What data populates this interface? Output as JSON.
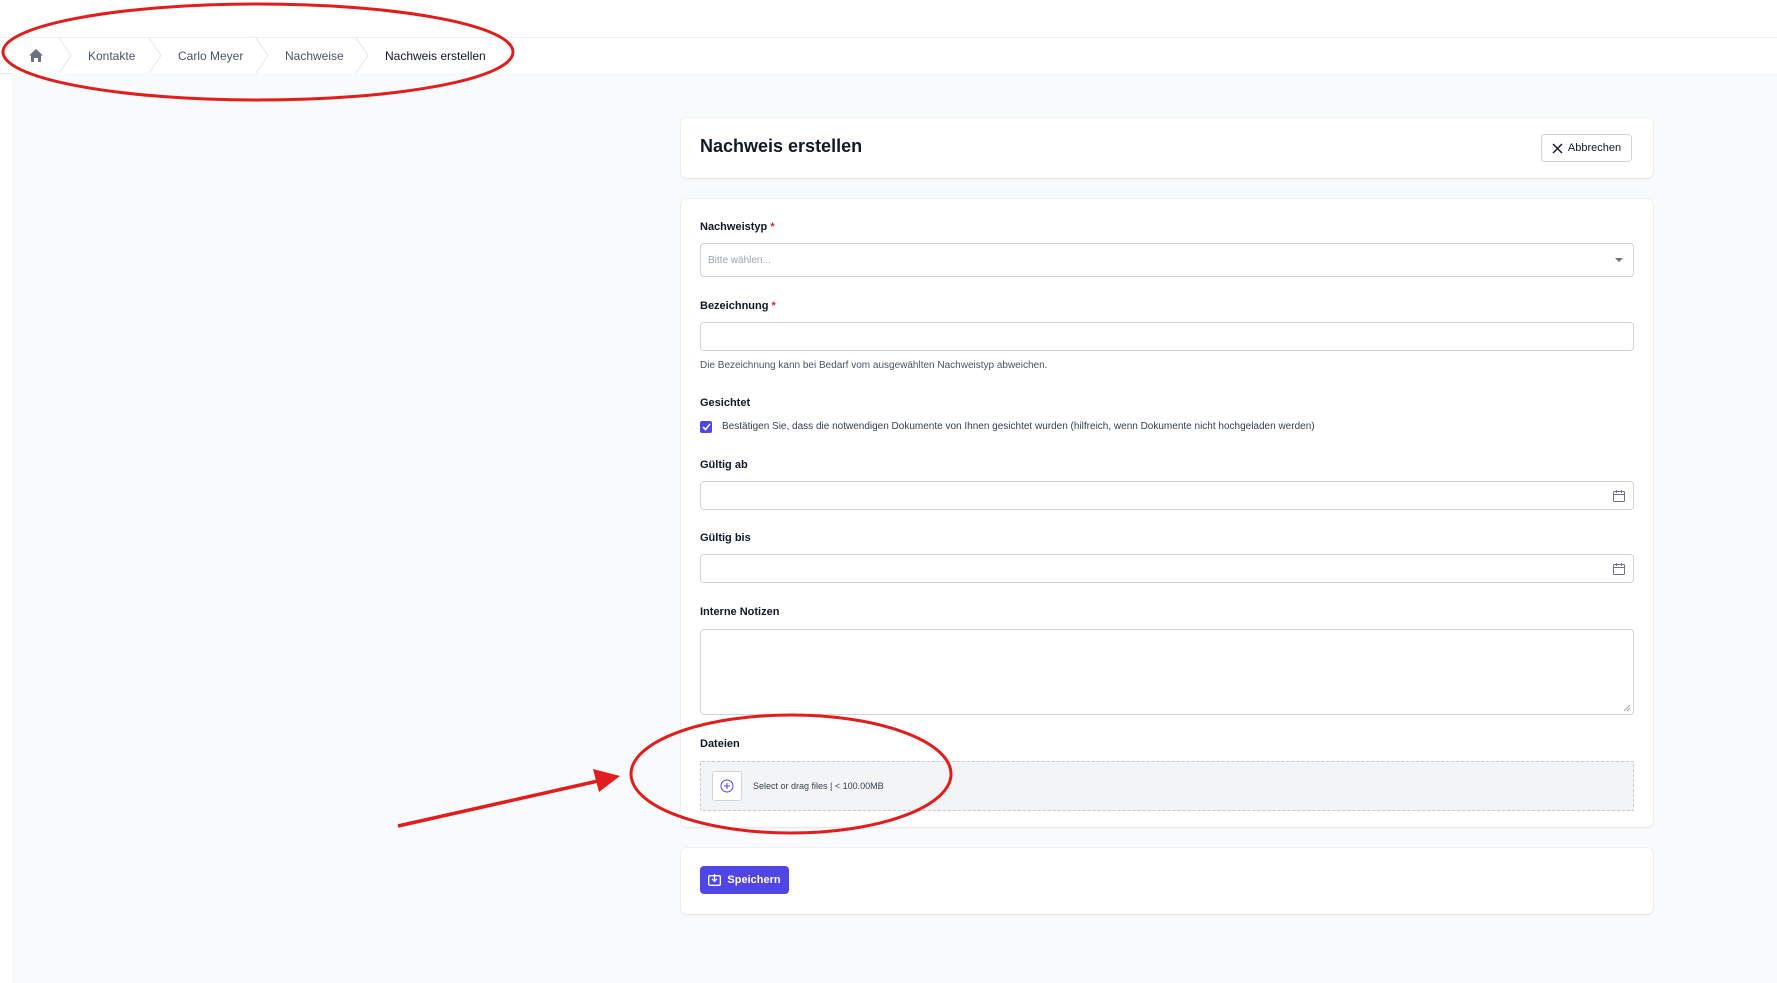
{
  "breadcrumb": {
    "items": [
      {
        "label": "Kontakte"
      },
      {
        "label": "Carlo Meyer"
      },
      {
        "label": "Nachweise"
      },
      {
        "label": "Nachweis erstellen"
      }
    ]
  },
  "header": {
    "title": "Nachweis erstellen",
    "cancel_label": "Abbrechen"
  },
  "form": {
    "nachweistyp": {
      "label": "Nachweistyp",
      "required_mark": "*",
      "placeholder": "Bitte wählen..."
    },
    "bezeichnung": {
      "label": "Bezeichnung",
      "required_mark": "*",
      "value": "",
      "help": "Die Bezeichnung kann bei Bedarf vom ausgewählten Nachweistyp abweichen."
    },
    "gesichtet": {
      "label": "Gesichtet",
      "checked": true,
      "checkbox_label": "Bestätigen Sie, dass die notwendigen Dokumente von Ihnen gesichtet wurden (hilfreich, wenn Dokumente nicht hochgeladen werden)"
    },
    "gueltig_ab": {
      "label": "Gültig ab",
      "value": ""
    },
    "gueltig_bis": {
      "label": "Gültig bis",
      "value": ""
    },
    "notizen": {
      "label": "Interne Notizen",
      "value": ""
    },
    "dateien": {
      "label": "Dateien",
      "dropzone_text": "Select or drag files | < 100.00MB"
    }
  },
  "footer": {
    "save_label": "Speichern"
  },
  "colors": {
    "accent": "#4f46e5",
    "annotation": "#e11d1d",
    "required": "#dc2626"
  },
  "icons": [
    "home-icon",
    "close-icon",
    "chevron-down-icon",
    "calendar-icon",
    "plus-circle-icon",
    "save-icon",
    "check-icon"
  ]
}
